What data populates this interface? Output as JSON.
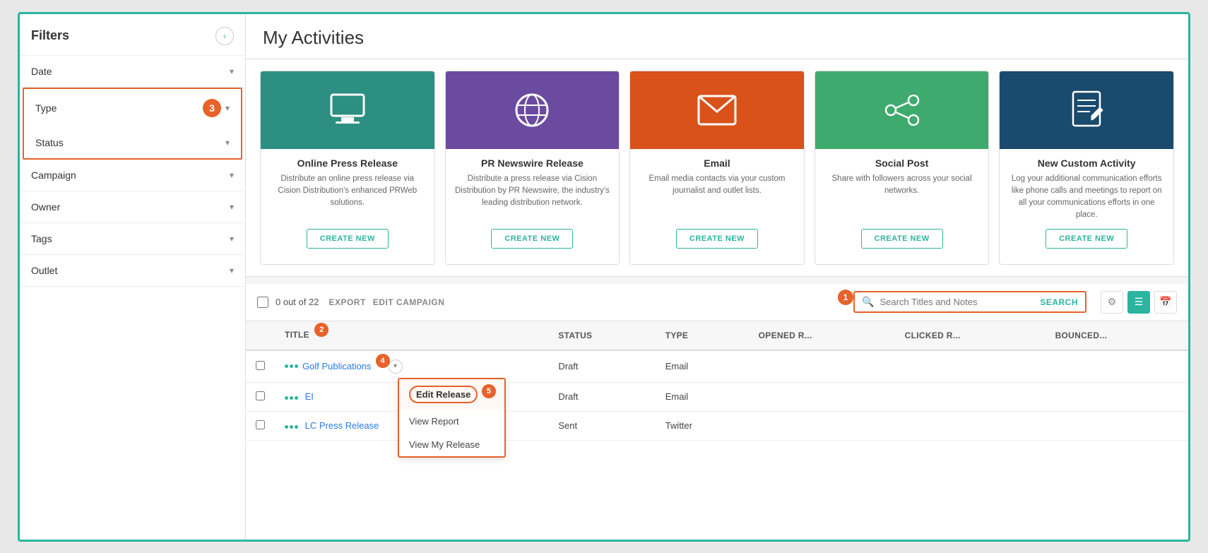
{
  "sidebar": {
    "title": "Filters",
    "collapse_icon": "‹",
    "filters": [
      {
        "id": "date",
        "label": "Date",
        "highlighted": false
      },
      {
        "id": "type",
        "label": "Type",
        "highlighted": true
      },
      {
        "id": "status",
        "label": "Status",
        "highlighted": true
      },
      {
        "id": "campaign",
        "label": "Campaign",
        "highlighted": false
      },
      {
        "id": "owner",
        "label": "Owner",
        "highlighted": false
      },
      {
        "id": "tags",
        "label": "Tags",
        "highlighted": false
      },
      {
        "id": "outlet",
        "label": "Outlet",
        "highlighted": false
      }
    ],
    "badge_3": "3"
  },
  "main": {
    "page_title": "My Activities",
    "cards": [
      {
        "id": "online-press-release",
        "name": "Online Press Release",
        "desc": "Distribute an online press release via Cision Distribution's enhanced PRWeb solutions.",
        "bg_color": "#2c8f82",
        "icon": "🖥",
        "btn_label": "CREATE NEW"
      },
      {
        "id": "pr-newswire-release",
        "name": "PR Newswire Release",
        "desc": "Distribute a press release via Cision Distribution by PR Newswire, the industry's leading distribution network.",
        "bg_color": "#6b4ba0",
        "icon": "🌐",
        "btn_label": "CREATE NEW"
      },
      {
        "id": "email",
        "name": "Email",
        "desc": "Email media contacts via your custom journalist and outlet lists.",
        "bg_color": "#d95219",
        "icon": "✉",
        "btn_label": "CREATE NEW"
      },
      {
        "id": "social-post",
        "name": "Social Post",
        "desc": "Share with followers across your social networks.",
        "bg_color": "#3faa6e",
        "icon": "⟨⟩",
        "btn_label": "CREATE NEW"
      },
      {
        "id": "new-custom-activity",
        "name": "New Custom Activity",
        "desc": "Log your additional communication efforts like phone calls and meetings to report on all your communications efforts in one place.",
        "bg_color": "#1a4a6e",
        "icon": "✏",
        "btn_label": "CREATE NEW"
      }
    ],
    "toolbar": {
      "count_text": "0 out of 22",
      "export_label": "EXPORT",
      "edit_campaign_label": "EDIT CAMPAIGN",
      "search_placeholder": "Search Titles and Notes",
      "search_button": "SEARCH",
      "badge_1": "1"
    },
    "table": {
      "columns": [
        "",
        "TITLE",
        "STATUS",
        "TYPE",
        "OPENED R...",
        "CLICKED R...",
        "BOUNCED..."
      ],
      "rows": [
        {
          "id": "row-1",
          "title": "Golf Publications",
          "status": "Draft",
          "type": "Email",
          "opened": "",
          "clicked": "",
          "bounced": "",
          "has_dropdown": true,
          "dropdown_open": true
        },
        {
          "id": "row-2",
          "title": "EI",
          "status": "Draft",
          "type": "Email",
          "opened": "",
          "clicked": "",
          "bounced": "",
          "has_dropdown": false,
          "dropdown_open": false
        },
        {
          "id": "row-3",
          "title": "LC Press Release",
          "status": "Sent",
          "type": "Twitter",
          "opened": "",
          "clicked": "",
          "bounced": "",
          "has_dropdown": false,
          "dropdown_open": false
        }
      ],
      "dropdown_items": [
        "Edit Release",
        "View Report",
        "View My Release"
      ],
      "badge_2": "2",
      "badge_4": "4",
      "badge_5": "5"
    }
  }
}
